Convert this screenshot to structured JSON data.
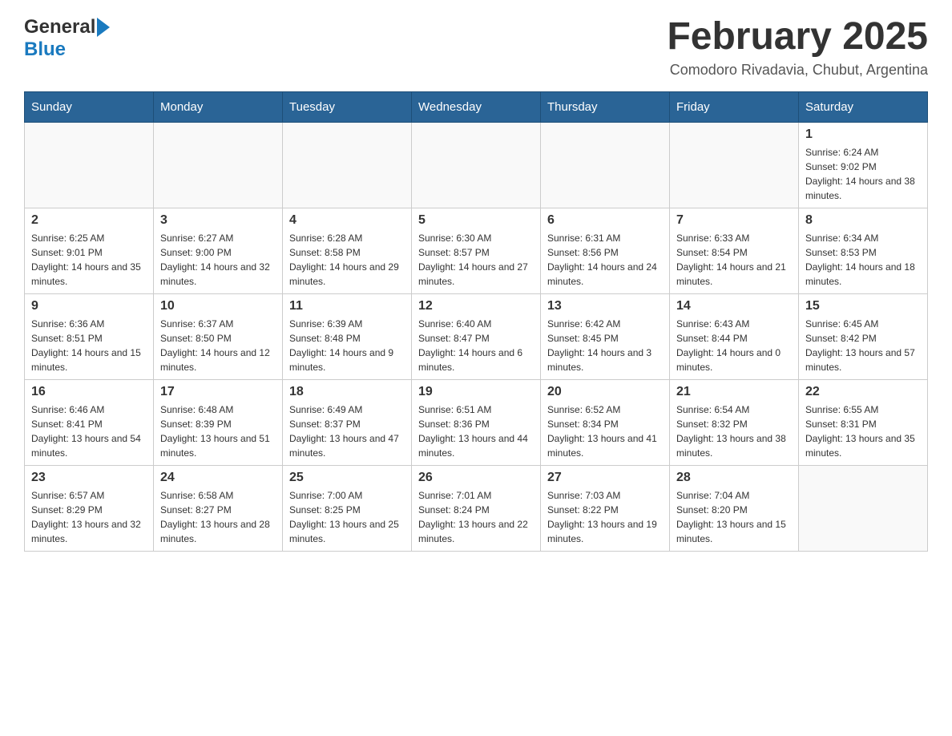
{
  "header": {
    "logo_general": "General",
    "logo_blue": "Blue",
    "title": "February 2025",
    "location": "Comodoro Rivadavia, Chubut, Argentina"
  },
  "days_of_week": [
    "Sunday",
    "Monday",
    "Tuesday",
    "Wednesday",
    "Thursday",
    "Friday",
    "Saturday"
  ],
  "weeks": [
    [
      {
        "day": "",
        "info": ""
      },
      {
        "day": "",
        "info": ""
      },
      {
        "day": "",
        "info": ""
      },
      {
        "day": "",
        "info": ""
      },
      {
        "day": "",
        "info": ""
      },
      {
        "day": "",
        "info": ""
      },
      {
        "day": "1",
        "info": "Sunrise: 6:24 AM\nSunset: 9:02 PM\nDaylight: 14 hours and 38 minutes."
      }
    ],
    [
      {
        "day": "2",
        "info": "Sunrise: 6:25 AM\nSunset: 9:01 PM\nDaylight: 14 hours and 35 minutes."
      },
      {
        "day": "3",
        "info": "Sunrise: 6:27 AM\nSunset: 9:00 PM\nDaylight: 14 hours and 32 minutes."
      },
      {
        "day": "4",
        "info": "Sunrise: 6:28 AM\nSunset: 8:58 PM\nDaylight: 14 hours and 29 minutes."
      },
      {
        "day": "5",
        "info": "Sunrise: 6:30 AM\nSunset: 8:57 PM\nDaylight: 14 hours and 27 minutes."
      },
      {
        "day": "6",
        "info": "Sunrise: 6:31 AM\nSunset: 8:56 PM\nDaylight: 14 hours and 24 minutes."
      },
      {
        "day": "7",
        "info": "Sunrise: 6:33 AM\nSunset: 8:54 PM\nDaylight: 14 hours and 21 minutes."
      },
      {
        "day": "8",
        "info": "Sunrise: 6:34 AM\nSunset: 8:53 PM\nDaylight: 14 hours and 18 minutes."
      }
    ],
    [
      {
        "day": "9",
        "info": "Sunrise: 6:36 AM\nSunset: 8:51 PM\nDaylight: 14 hours and 15 minutes."
      },
      {
        "day": "10",
        "info": "Sunrise: 6:37 AM\nSunset: 8:50 PM\nDaylight: 14 hours and 12 minutes."
      },
      {
        "day": "11",
        "info": "Sunrise: 6:39 AM\nSunset: 8:48 PM\nDaylight: 14 hours and 9 minutes."
      },
      {
        "day": "12",
        "info": "Sunrise: 6:40 AM\nSunset: 8:47 PM\nDaylight: 14 hours and 6 minutes."
      },
      {
        "day": "13",
        "info": "Sunrise: 6:42 AM\nSunset: 8:45 PM\nDaylight: 14 hours and 3 minutes."
      },
      {
        "day": "14",
        "info": "Sunrise: 6:43 AM\nSunset: 8:44 PM\nDaylight: 14 hours and 0 minutes."
      },
      {
        "day": "15",
        "info": "Sunrise: 6:45 AM\nSunset: 8:42 PM\nDaylight: 13 hours and 57 minutes."
      }
    ],
    [
      {
        "day": "16",
        "info": "Sunrise: 6:46 AM\nSunset: 8:41 PM\nDaylight: 13 hours and 54 minutes."
      },
      {
        "day": "17",
        "info": "Sunrise: 6:48 AM\nSunset: 8:39 PM\nDaylight: 13 hours and 51 minutes."
      },
      {
        "day": "18",
        "info": "Sunrise: 6:49 AM\nSunset: 8:37 PM\nDaylight: 13 hours and 47 minutes."
      },
      {
        "day": "19",
        "info": "Sunrise: 6:51 AM\nSunset: 8:36 PM\nDaylight: 13 hours and 44 minutes."
      },
      {
        "day": "20",
        "info": "Sunrise: 6:52 AM\nSunset: 8:34 PM\nDaylight: 13 hours and 41 minutes."
      },
      {
        "day": "21",
        "info": "Sunrise: 6:54 AM\nSunset: 8:32 PM\nDaylight: 13 hours and 38 minutes."
      },
      {
        "day": "22",
        "info": "Sunrise: 6:55 AM\nSunset: 8:31 PM\nDaylight: 13 hours and 35 minutes."
      }
    ],
    [
      {
        "day": "23",
        "info": "Sunrise: 6:57 AM\nSunset: 8:29 PM\nDaylight: 13 hours and 32 minutes."
      },
      {
        "day": "24",
        "info": "Sunrise: 6:58 AM\nSunset: 8:27 PM\nDaylight: 13 hours and 28 minutes."
      },
      {
        "day": "25",
        "info": "Sunrise: 7:00 AM\nSunset: 8:25 PM\nDaylight: 13 hours and 25 minutes."
      },
      {
        "day": "26",
        "info": "Sunrise: 7:01 AM\nSunset: 8:24 PM\nDaylight: 13 hours and 22 minutes."
      },
      {
        "day": "27",
        "info": "Sunrise: 7:03 AM\nSunset: 8:22 PM\nDaylight: 13 hours and 19 minutes."
      },
      {
        "day": "28",
        "info": "Sunrise: 7:04 AM\nSunset: 8:20 PM\nDaylight: 13 hours and 15 minutes."
      },
      {
        "day": "",
        "info": ""
      }
    ]
  ]
}
